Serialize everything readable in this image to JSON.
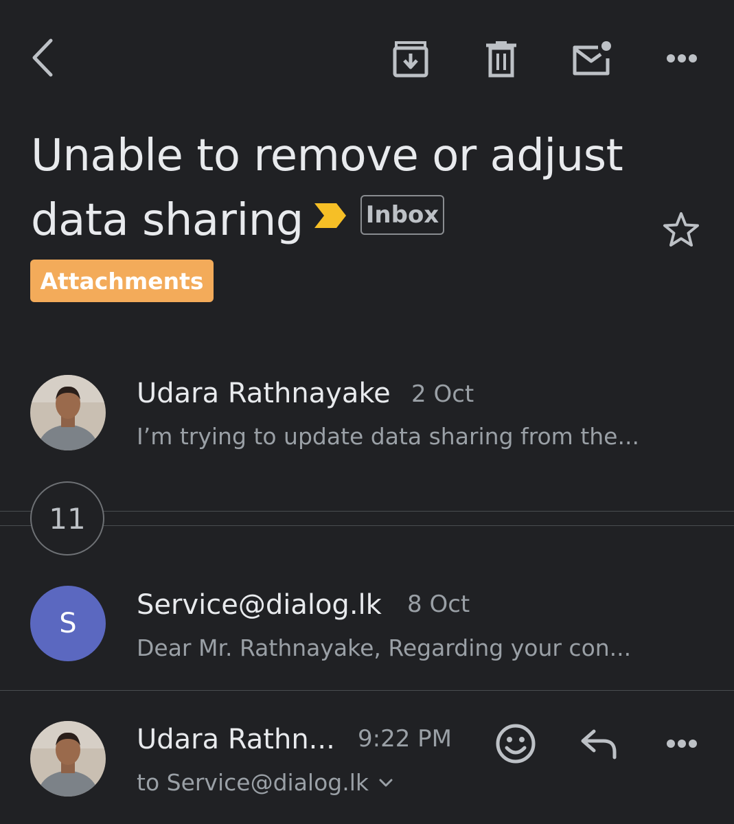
{
  "toolbar": {
    "back_icon": "chevron-left-icon",
    "archive_icon": "archive-icon",
    "delete_icon": "trash-icon",
    "mark_unread_icon": "mail-unread-icon",
    "more_icon": "more-horizontal-icon"
  },
  "thread": {
    "subject_line1": "Unable to remove or adjust",
    "subject_line2": "data sharing",
    "importance_marker_color": "#f6bf26",
    "label_inbox": "Inbox",
    "label_attachments": "Attachments",
    "label_attachments_color": "#f3ab5a",
    "star_icon": "star-outline-icon"
  },
  "messages": [
    {
      "sender": "Udara Rathnayake",
      "date": "2 Oct",
      "snippet": "I’m trying to update data sharing from the..."
    },
    {
      "collapsed_count": "11"
    },
    {
      "avatar_letter": "S",
      "avatar_color": "#5b68c0",
      "sender": "Service@dialog.lk",
      "date": "8 Oct",
      "snippet": "Dear Mr. Rathnayake, Regarding your con..."
    },
    {
      "sender": "Udara Rathn...",
      "time": "9:22 PM",
      "recipient": "to Service@dialog.lk",
      "emoji_icon": "emoji-react-icon",
      "reply_icon": "reply-icon",
      "more_icon": "more-horizontal-icon"
    }
  ]
}
